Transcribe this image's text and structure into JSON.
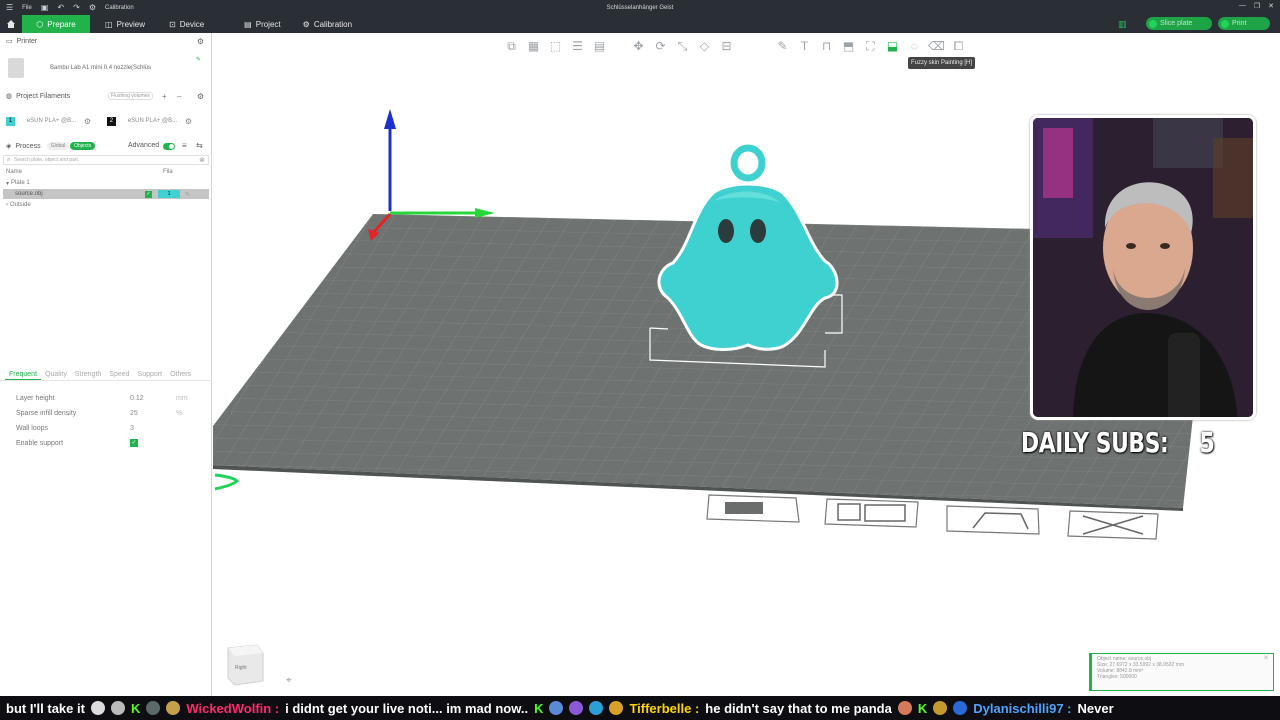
{
  "app": {
    "window_title": "Schlüsselanhänger Geist",
    "menu_file": "File",
    "calibration_menu": "Calibration"
  },
  "nav": {
    "tabs": [
      {
        "label": "Prepare",
        "icon": "prepare-icon",
        "active": true
      },
      {
        "label": "Preview",
        "icon": "preview-icon",
        "active": false
      },
      {
        "label": "Device",
        "icon": "device-icon",
        "active": false
      },
      {
        "label": "Project",
        "icon": "project-icon",
        "active": false
      },
      {
        "label": "Calibration",
        "icon": "calibration-icon",
        "active": false
      }
    ],
    "slice_label": "Slice plate",
    "print_label": "Print"
  },
  "left_panel": {
    "printer_heading": "Printer",
    "printer_name": "Bambu Lab A1 mini 0.4 nozzle(Schlüs",
    "filaments_heading": "Project Filaments",
    "flushing_label": "Flushing volumes",
    "filaments": [
      {
        "num": "1",
        "name": "eSUN PLA+ @B...",
        "color": "#3fd1cf"
      },
      {
        "num": "2",
        "name": "eSUN PLA+ @B...",
        "color": "#111111"
      }
    ],
    "process_heading": "Process",
    "global_label": "Global",
    "objects_label": "Objects",
    "advanced_label": "Advanced",
    "search_placeholder": "Search plate, object and part.",
    "col_name": "Name",
    "col_fila": "Fila",
    "tree": [
      {
        "label": "Plate 1",
        "selected": false
      },
      {
        "label": "source.obj",
        "selected": true,
        "fila": "1"
      },
      {
        "label": "Outside",
        "selected": false
      }
    ],
    "setting_tabs": [
      "Frequent",
      "Quality",
      "Strength",
      "Speed",
      "Support",
      "Others"
    ],
    "settings": [
      {
        "label": "Layer height",
        "value": "0.12",
        "unit": "mm"
      },
      {
        "label": "Sparse infill density",
        "value": "25",
        "unit": "%"
      },
      {
        "label": "Wall loops",
        "value": "3",
        "unit": ""
      },
      {
        "label": "Enable support",
        "value": "",
        "unit": ""
      }
    ]
  },
  "viewport": {
    "tooltip": "Fuzzy skin Painting [H]",
    "view_cube_label": "Right",
    "object_info": [
      "Object name: source.obj",
      "Size: 27.6972 x 33.5992 x 38.9532 mm",
      "Volume: 8842.8 mm³",
      "Triangles: 500000"
    ],
    "model_color": "#3fd1cf",
    "plate_color": "#6e7270",
    "accent": "#21b24b"
  },
  "overlay": {
    "daily_subs_label": "DAILY SUBS:",
    "daily_subs_value": "5"
  },
  "ticker": {
    "prefix": "but I'll take it",
    "messages": [
      {
        "name": "WickedWolfin",
        "name_color": "#ff2a6d",
        "text": "i didnt get your live noti... im mad now.."
      },
      {
        "name": "Tifferbelle",
        "name_color": "#ffd400",
        "text": "he didn't say that to me panda"
      },
      {
        "name": "Dylanischilli97",
        "name_color": "#4da3ff",
        "text": "Never"
      }
    ]
  }
}
